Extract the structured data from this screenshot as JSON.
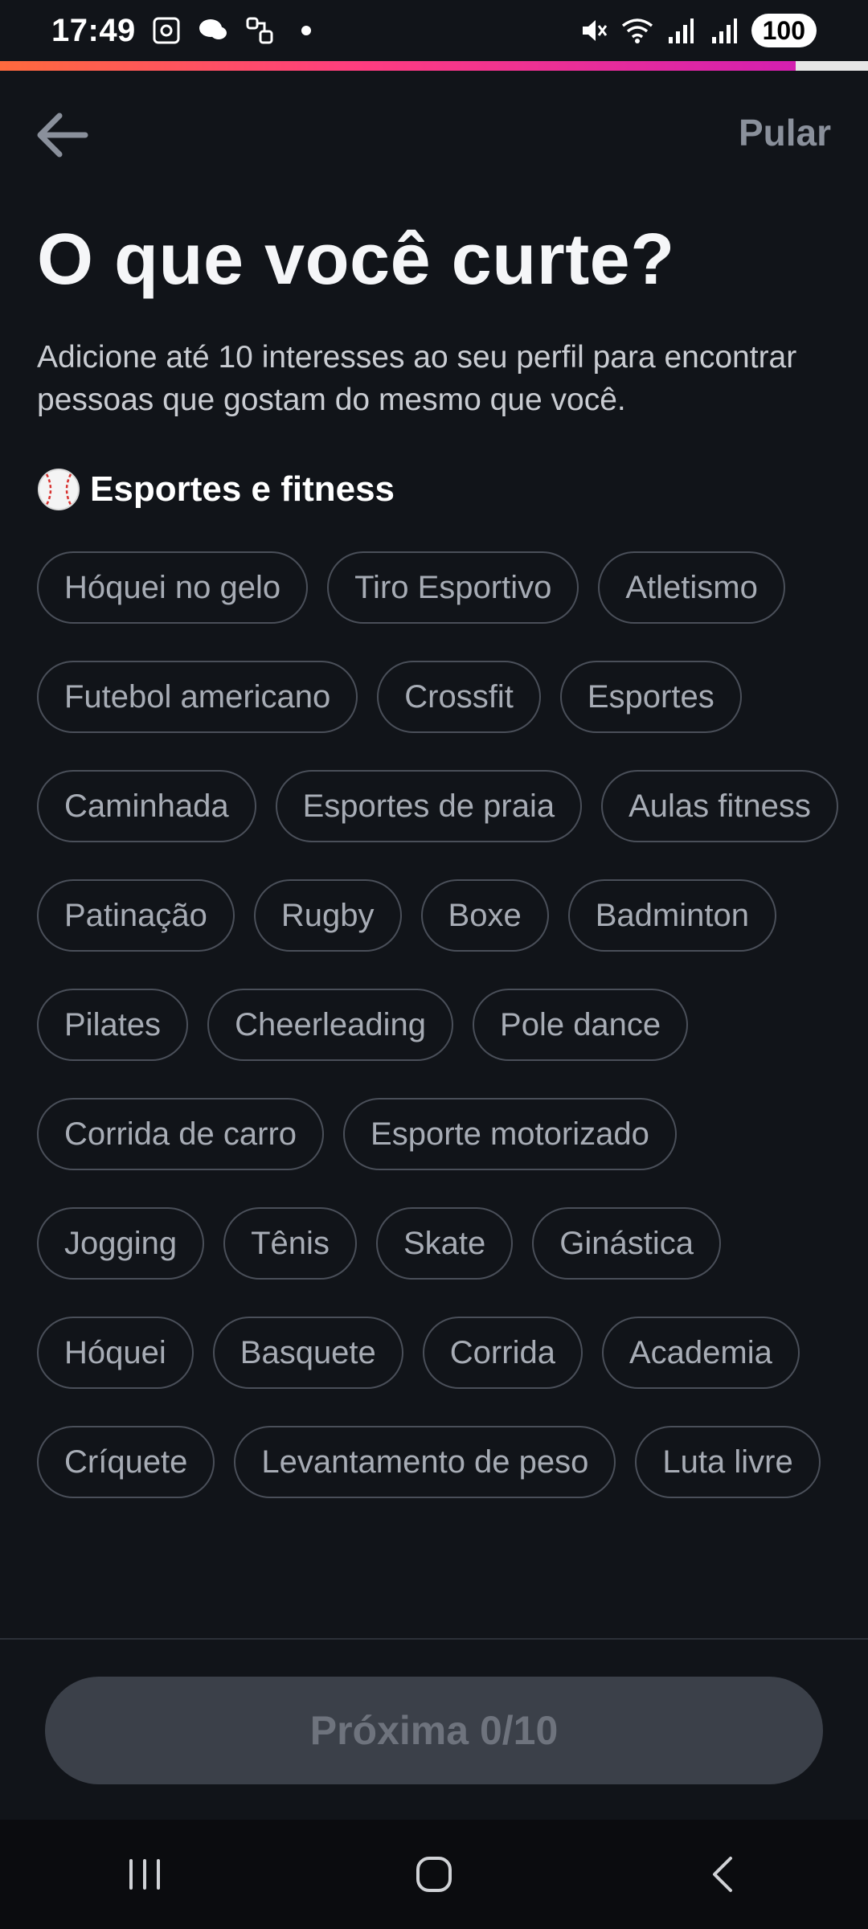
{
  "status_bar": {
    "time": "17:49",
    "battery": "100"
  },
  "progress": {
    "fraction": 0.917,
    "colors": [
      "#ff6a3d",
      "#ff3d7f",
      "#d41fb0"
    ]
  },
  "header": {
    "skip_label": "Pular"
  },
  "title": "O que você curte?",
  "subtitle": "Adicione até 10 interesses ao seu perfil para encontrar pessoas que gostam do mesmo que você.",
  "section": {
    "title": "Esportes e fitness",
    "icon": "baseball-icon"
  },
  "interests": [
    "Hóquei no gelo",
    "Tiro Esportivo",
    "Atletismo",
    "Futebol americano",
    "Crossfit",
    "Esportes",
    "Caminhada",
    "Esportes de praia",
    "Aulas fitness",
    "Patinação",
    "Rugby",
    "Boxe",
    "Badminton",
    "Pilates",
    "Cheerleading",
    "Pole dance",
    "Corrida de carro",
    "Esporte motorizado",
    "Jogging",
    "Tênis",
    "Skate",
    "Ginástica",
    "Hóquei",
    "Basquete",
    "Corrida",
    "Academia",
    "Críquete",
    "Levantamento de peso",
    "Luta livre"
  ],
  "footer": {
    "next_label": "Próxima 0/10"
  },
  "colors": {
    "background": "#111419",
    "chip_border": "#4a4f59",
    "chip_text": "#a7acb5",
    "button_bg": "#3b4049"
  }
}
